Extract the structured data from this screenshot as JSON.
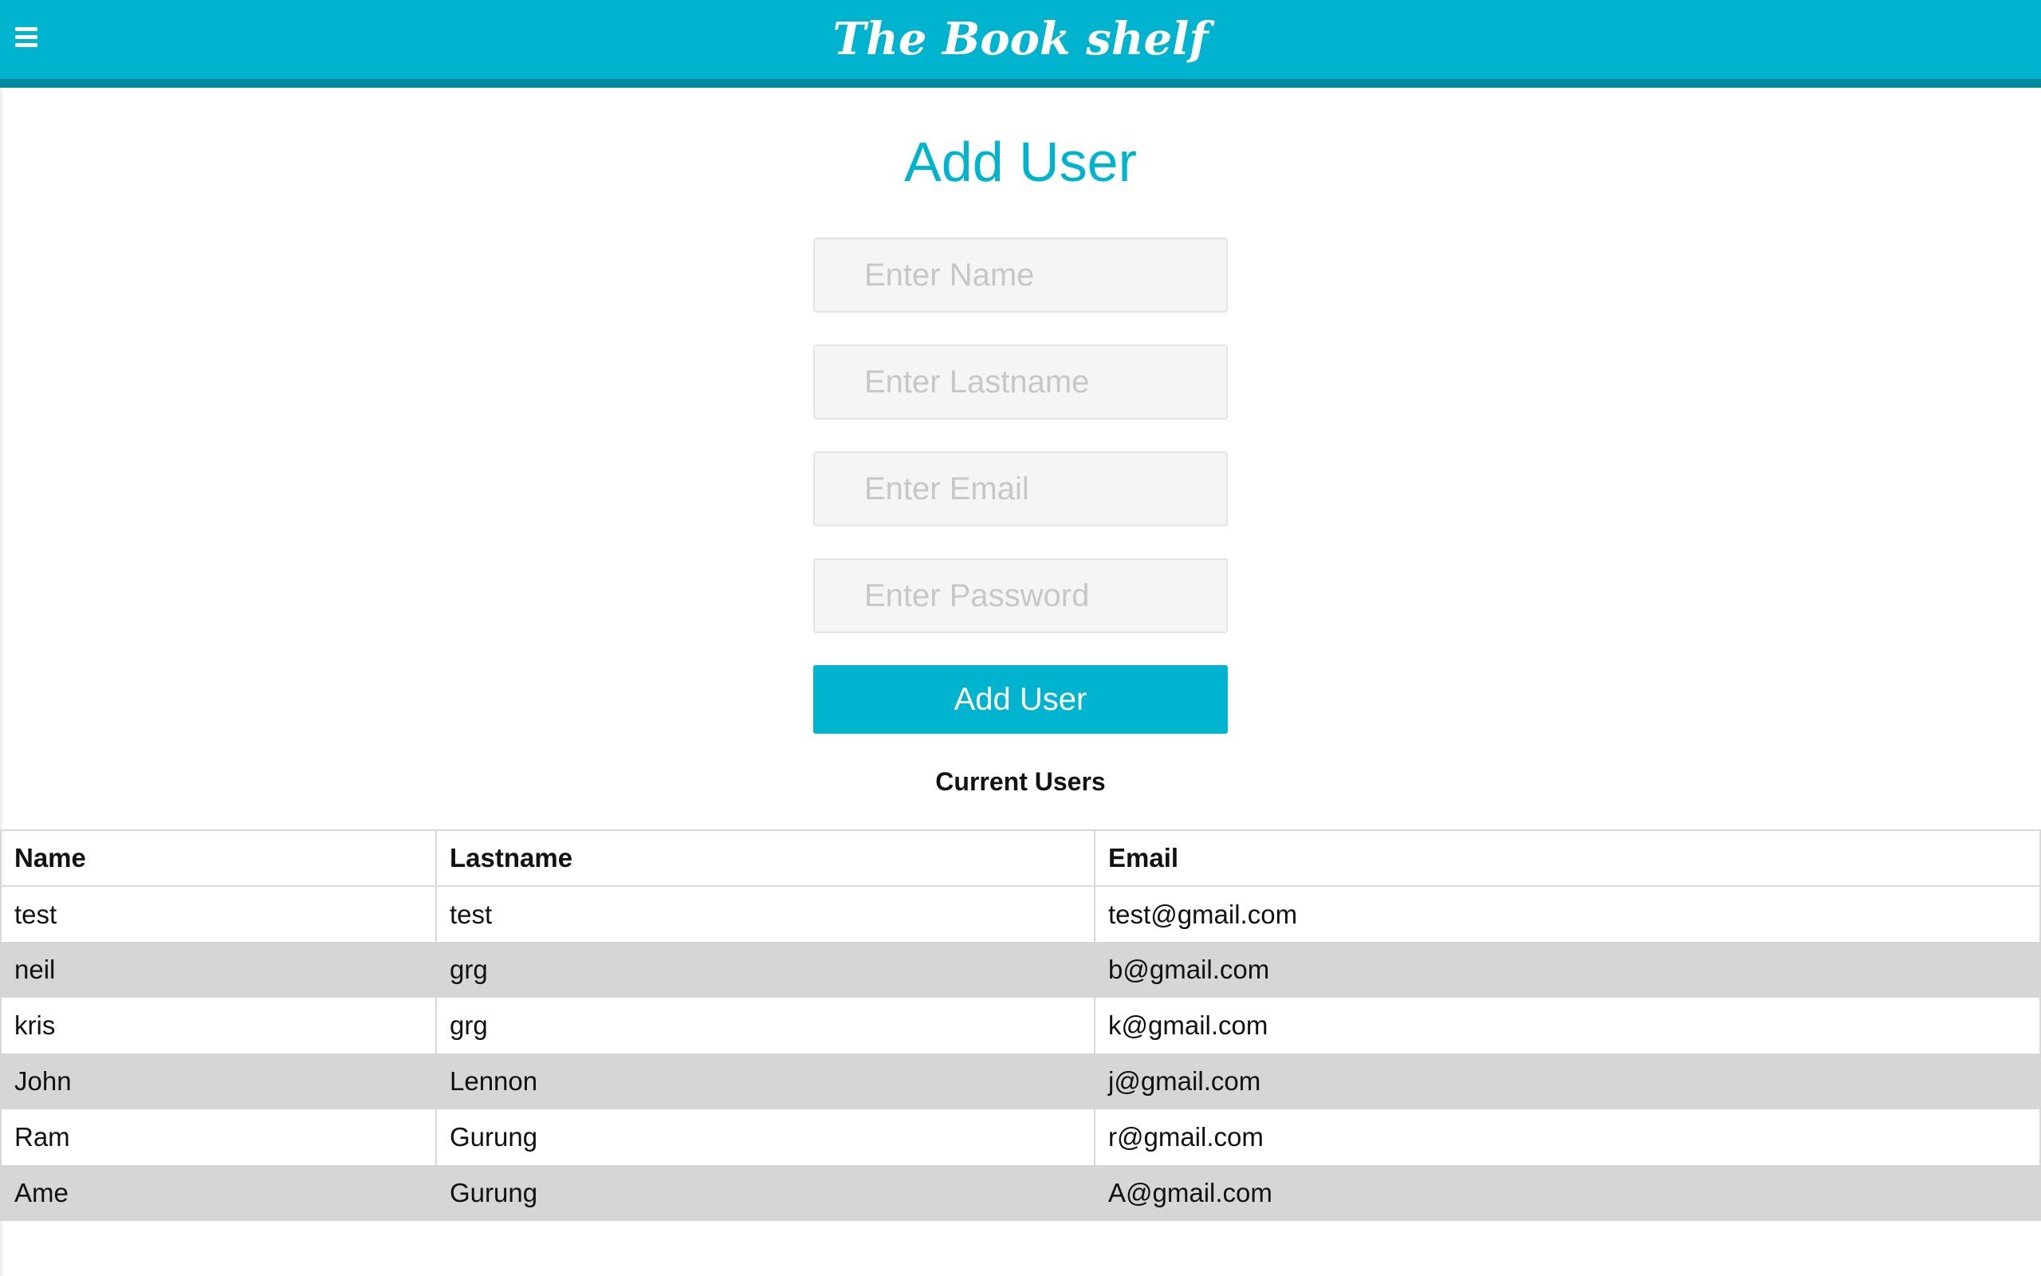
{
  "header": {
    "brand": "The Book shelf",
    "menu_icon": "hamburger-menu-icon"
  },
  "colors": {
    "accent": "#00b3cf",
    "accent_dark": "#00889e",
    "stripe": "#d6d6d6",
    "input_bg": "#f5f5f5"
  },
  "form": {
    "title": "Add User",
    "name_placeholder": "Enter Name",
    "lastname_placeholder": "Enter Lastname",
    "email_placeholder": "Enter Email",
    "password_placeholder": "Enter Password",
    "submit_label": "Add User"
  },
  "users": {
    "heading": "Current Users",
    "columns": [
      "Name",
      "Lastname",
      "Email"
    ],
    "rows": [
      [
        "test",
        "test",
        "test@gmail.com"
      ],
      [
        "neil",
        "grg",
        "b@gmail.com"
      ],
      [
        "kris",
        "grg",
        "k@gmail.com"
      ],
      [
        "John",
        "Lennon",
        "j@gmail.com"
      ],
      [
        "Ram",
        "Gurung",
        "r@gmail.com"
      ],
      [
        "Ame",
        "Gurung",
        "A@gmail.com"
      ]
    ]
  }
}
